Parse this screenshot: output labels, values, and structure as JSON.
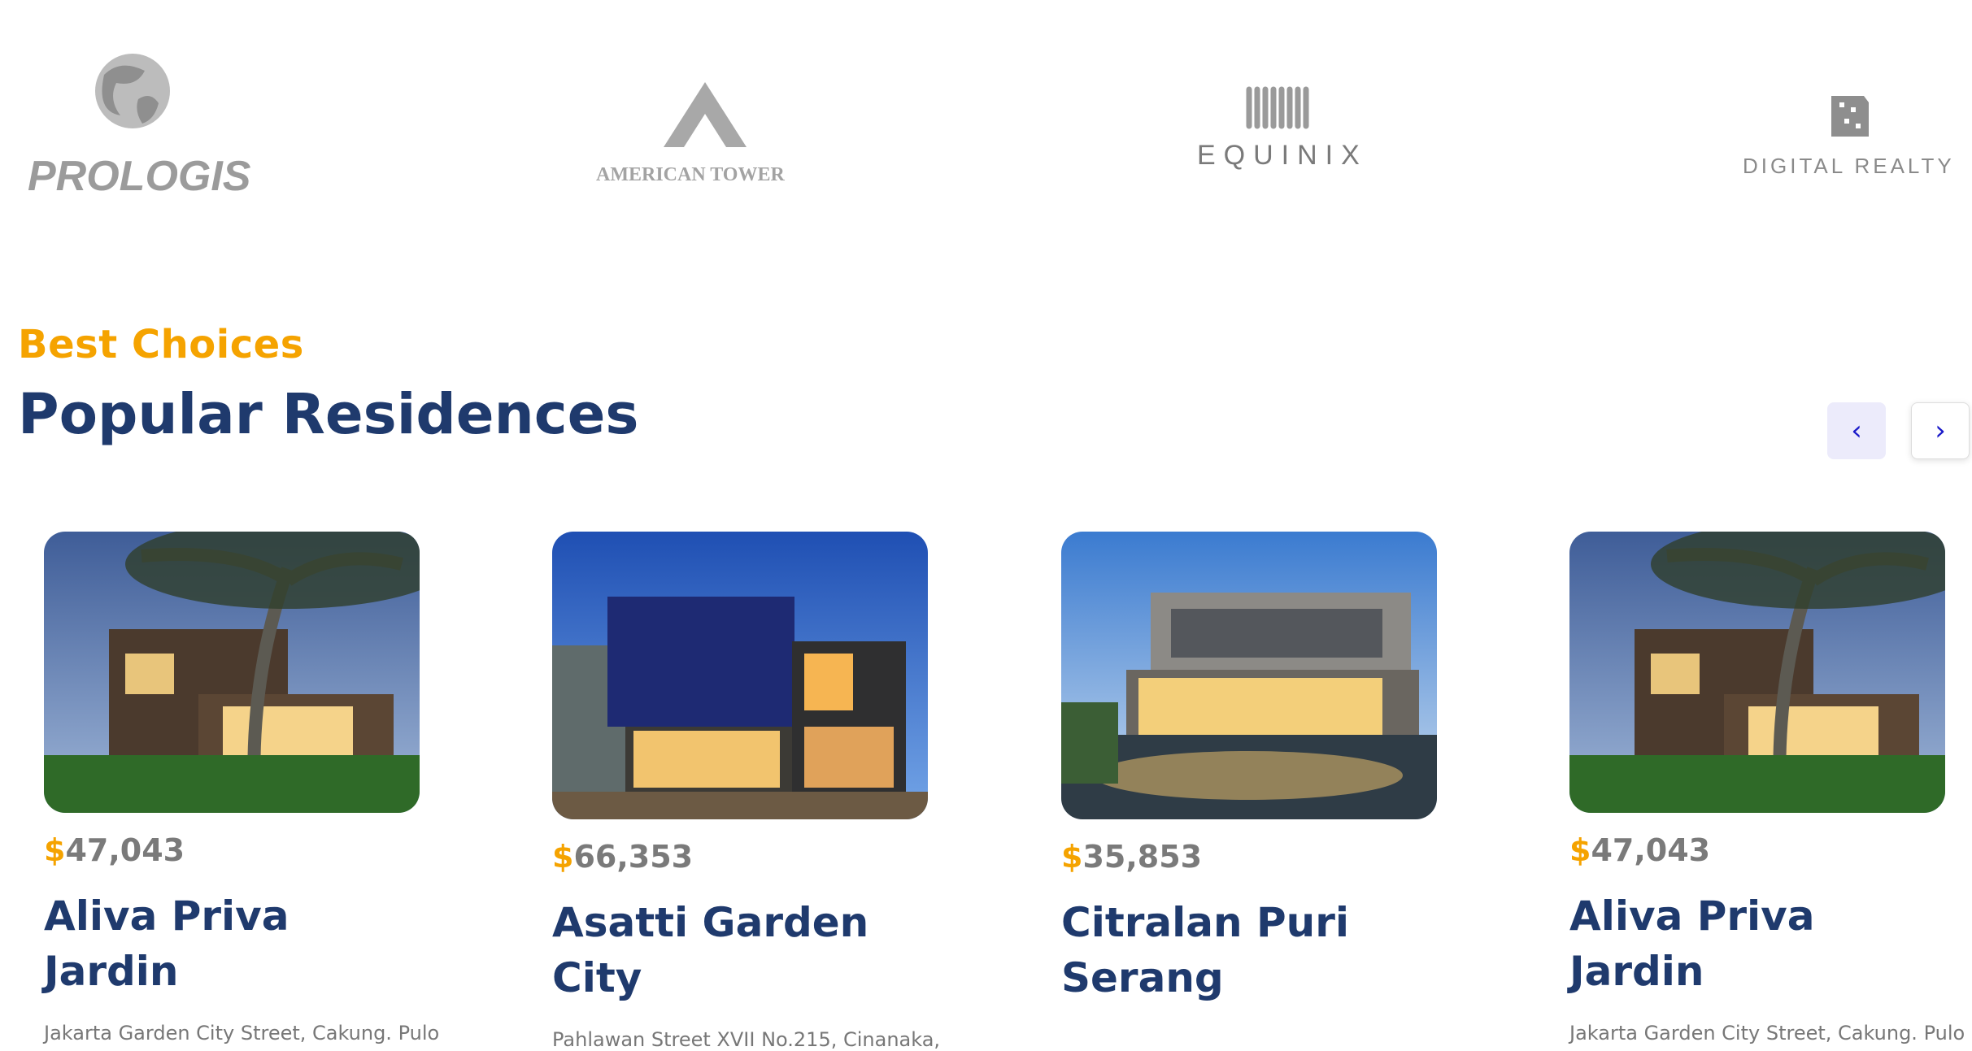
{
  "partners": [
    {
      "name": "PROLOGIS"
    },
    {
      "name": "AMERICAN TOWER"
    },
    {
      "name": "EQUINIX"
    },
    {
      "name": "DIGITAL REALTY"
    }
  ],
  "section": {
    "eyebrow": "Best Choices",
    "title": "Popular Residences",
    "prev_label": "‹",
    "next_label": "›"
  },
  "currency_symbol": "$",
  "residences": [
    {
      "price": "47,043",
      "name": "Aliva Priva Jardin",
      "address": "Jakarta Garden City Street, Cakung. Pulo"
    },
    {
      "price": "66,353",
      "name": "Asatti Garden City",
      "address": "Pahlawan Street XVII No.215, Cinanaka,"
    },
    {
      "price": "35,853",
      "name": "Citralan Puri Serang",
      "address": ""
    },
    {
      "price": "47,043",
      "name": "Aliva Priva Jardin",
      "address": "Jakarta Garden City Street, Cakung. Pulo"
    }
  ]
}
